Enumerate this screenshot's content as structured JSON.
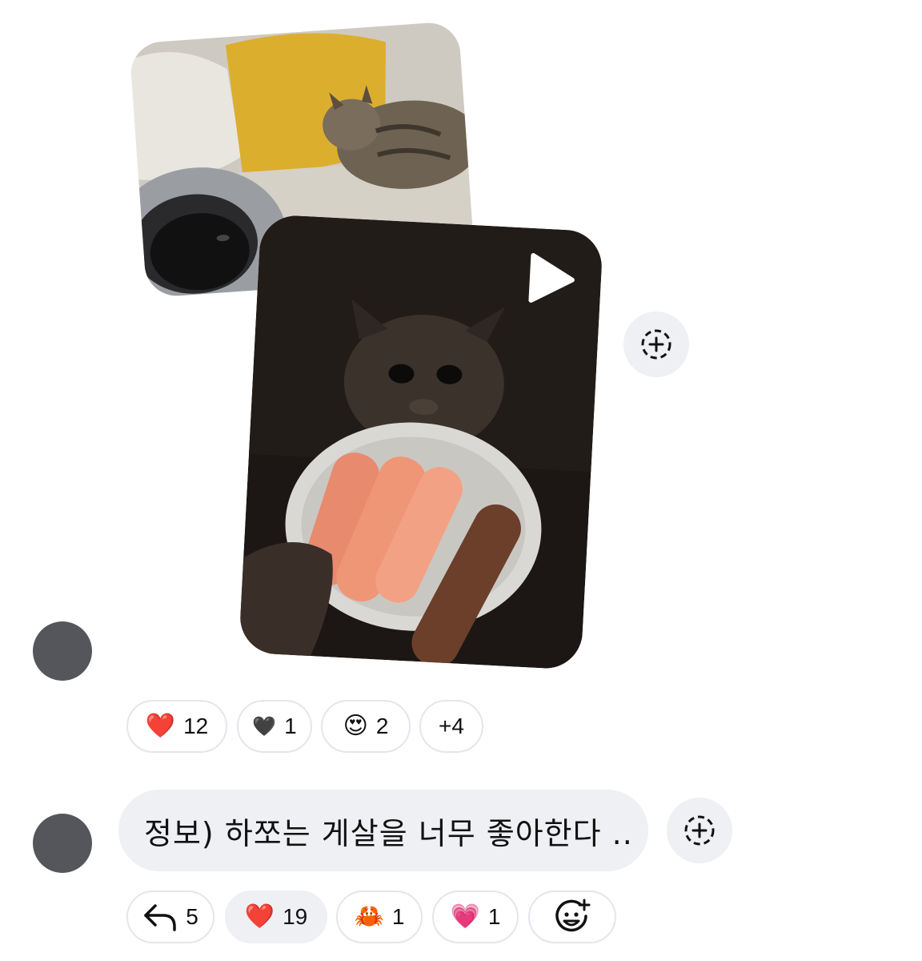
{
  "media": [
    {
      "name": "photo-cats-on-sofa"
    },
    {
      "name": "video-cat-with-crab",
      "has_play_icon": true
    }
  ],
  "reactions_top": [
    {
      "emoji": "❤️",
      "count": "12"
    },
    {
      "emoji": "🖤",
      "count": "1"
    },
    {
      "emoji": "😍",
      "count": "2"
    },
    {
      "emoji": "",
      "count": "+4"
    }
  ],
  "message": {
    "text": "정보) 하쪼는 게살을 너무 좋아한다 .."
  },
  "reactions_bottom": [
    {
      "emoji": "↩",
      "count": "5"
    },
    {
      "emoji": "❤️",
      "count": "19",
      "active": true
    },
    {
      "emoji": "🦀",
      "count": "1"
    },
    {
      "emoji": "💗",
      "count": "1"
    }
  ],
  "colors": {
    "avatar": "#55565b",
    "chip_bg_active": "#eef0f3",
    "bubble_bg": "#eef0f3"
  }
}
